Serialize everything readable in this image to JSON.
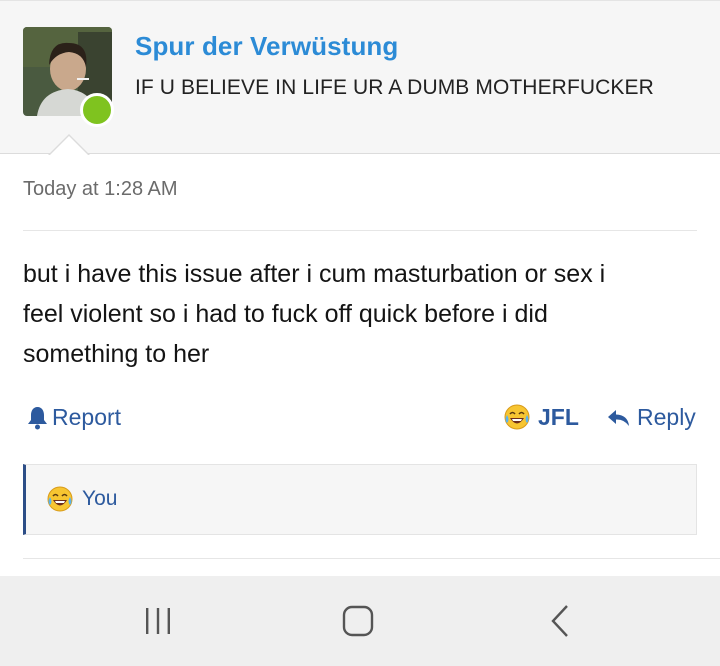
{
  "post": {
    "username": "Spur der Verwüstung",
    "user_title": "IF U BELIEVE IN LIFE UR A DUMB MOTHERFUCKER",
    "timestamp": "Today at 1:28 AM",
    "body_lines": [
      "but i have this issue after i cum masturbation or sex i",
      "feel violent so i had to fuck off quick before i did",
      "something to her"
    ],
    "status": "online",
    "status_color": "#7fc31f"
  },
  "actions": {
    "report_label": "Report",
    "jfl_label": "JFL",
    "reply_label": "Reply"
  },
  "reactions": {
    "users_label": "You",
    "icon": "crying-laughing-emoji"
  },
  "colors": {
    "username": "#2c8bd6",
    "action": "#2d5a9e",
    "accent_border": "#2d4e87"
  },
  "navbar": {
    "buttons": [
      "recent-apps",
      "home",
      "back"
    ]
  }
}
